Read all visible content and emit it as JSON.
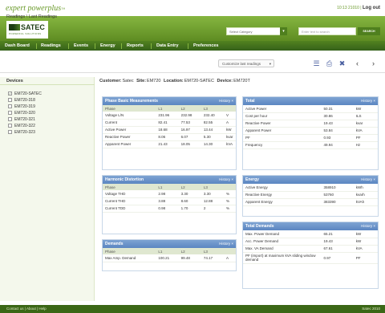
{
  "app": {
    "logo_text": "expert powerplus",
    "logo_tm": "™"
  },
  "toplinks": {
    "datetime": "10:13 21010 |",
    "logout": "Log out"
  },
  "brand": {
    "name": "SATEC",
    "tagline": "POWERFUL SOLUTIONS"
  },
  "search": {
    "category_label": "Select Category",
    "placeholder": "Enter text to search",
    "button": "SEARCH"
  },
  "nav": [
    "Dash Board",
    "Readings",
    "Events",
    "Energy",
    "Reports",
    "Data Entry",
    "Preferences"
  ],
  "crumb": {
    "text": "Readings \\ Last Readings"
  },
  "toolbar": {
    "customize_label": "Customize last readings",
    "customize_arrow": "▾"
  },
  "sidebar": {
    "title": "Devices",
    "devices": [
      "EM720-SATEC",
      "EM720-318",
      "EM720-319",
      "EM720-320",
      "EM720-321",
      "EM720-322",
      "EM720-323"
    ],
    "checked_index": 0
  },
  "info": {
    "customer_label": "Customer:",
    "customer": "Satec",
    "site_label": "Site:",
    "site": "EM720",
    "location_label": "Location:",
    "location": "EM720-SATEC",
    "device_label": "Device:",
    "device": "EM720T"
  },
  "history_label": "History",
  "close_glyph": "×",
  "panels": {
    "phase": {
      "title": "Phase Basic Measurements",
      "headers": [
        "Phase",
        "L1",
        "L2",
        "L3",
        ""
      ],
      "rows": [
        [
          "Voltage L/N",
          "231.96",
          "232.98",
          "232.40",
          "V"
        ],
        [
          "Current",
          "82.41",
          "77.53",
          "82.55",
          "A"
        ],
        [
          "Active Power",
          "18.68",
          "16.97",
          "13.44",
          "kW"
        ],
        [
          "Reactive Power",
          "8.06",
          "6.07",
          "5.30",
          "kvar"
        ],
        [
          "Apparent Power",
          "21.43",
          "18.05",
          "14.30",
          "kVA"
        ]
      ]
    },
    "harmonic": {
      "title": "Harmonic Distortion",
      "headers": [
        "Phase",
        "L1",
        "L2",
        "L3",
        ""
      ],
      "rows": [
        [
          "Voltage THD",
          "2.98",
          "3.30",
          "3.30",
          "%"
        ],
        [
          "Current THD",
          "3.88",
          "8.60",
          "12.88",
          "%"
        ],
        [
          "Current TDD",
          "0.98",
          "1.70",
          "2",
          "%"
        ]
      ]
    },
    "demands": {
      "title": "Demands",
      "headers": [
        "Phase",
        "L1",
        "L2",
        "L3",
        ""
      ],
      "rows": [
        [
          "Max Amp. Demand",
          "100.21",
          "99.48",
          "74.17",
          "A"
        ]
      ]
    },
    "total": {
      "title": "Total",
      "rows": [
        [
          "Active Power",
          "50.31",
          "kW"
        ],
        [
          "Cost per hour",
          "30.86",
          "ILS"
        ],
        [
          "Reactive Power",
          "19.43",
          "kvar"
        ],
        [
          "Apparent Power",
          "53.84",
          "kVA"
        ],
        [
          "PF",
          "0.93",
          "PF"
        ],
        [
          "Frequency",
          "49.94",
          "Hz"
        ]
      ]
    },
    "energy": {
      "title": "Energy",
      "rows": [
        [
          "Active Energy",
          "358910",
          "kWh"
        ],
        [
          "Reactive Energy",
          "53760",
          "kvarh"
        ],
        [
          "Apparent Energy",
          "383390",
          "kVAh"
        ]
      ]
    },
    "total_demands": {
      "title": "Total Demands",
      "rows": [
        [
          "Max. Power Demand",
          "65.21",
          "kW"
        ],
        [
          "Acc. Power Demand",
          "19.43",
          "kW"
        ],
        [
          "Max. VA Demand",
          "67.61",
          "kVA"
        ],
        [
          "PF (import) at maximum kVA sliding window demand",
          "0.97",
          "PF"
        ]
      ]
    }
  },
  "footer": {
    "links": [
      "Contact us",
      "About",
      "Help"
    ],
    "right": "Satec 2010"
  }
}
